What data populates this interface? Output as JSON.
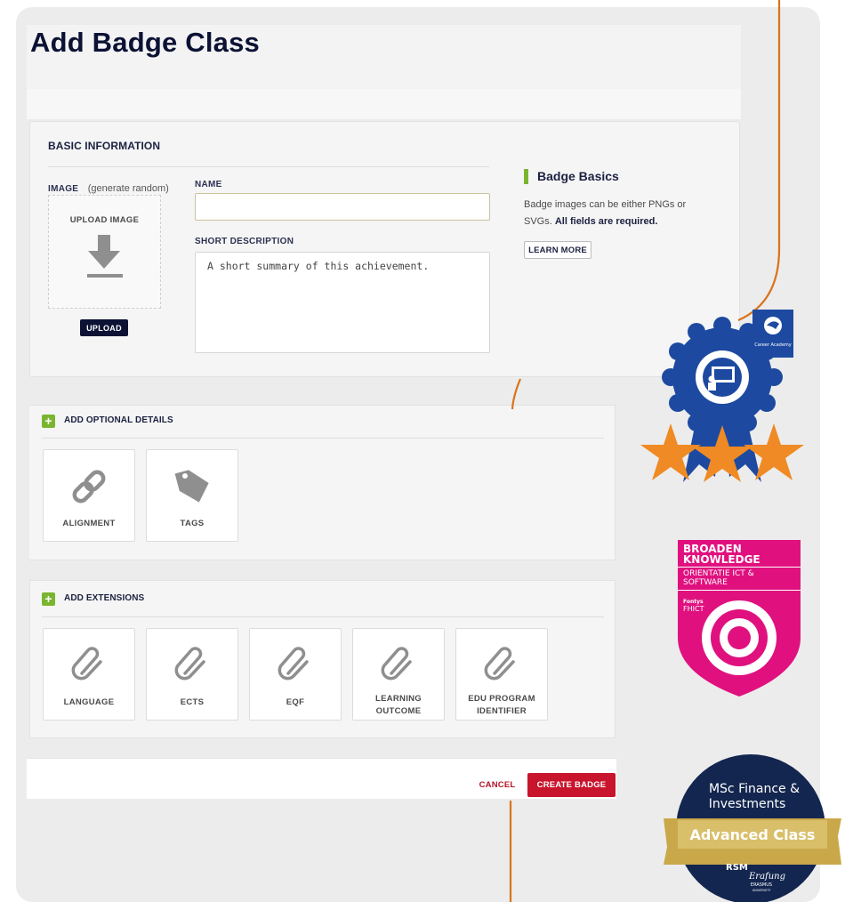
{
  "page": {
    "title": "Add Badge Class"
  },
  "basic_info": {
    "section_title": "BASIC INFORMATION",
    "image_label": "IMAGE",
    "generate_random": "(generate random)",
    "upload_image_label": "UPLOAD IMAGE",
    "upload_button": "UPLOAD",
    "name_label": "NAME",
    "name_value": "",
    "short_description_label": "SHORT DESCRIPTION",
    "short_description_placeholder": "A short summary of this achievement."
  },
  "badge_basics": {
    "title": "Badge Basics",
    "text_plain": "Badge images can be either PNGs or SVGs.",
    "text_bold": "All fields are required.",
    "learn_more": "LEARN MORE"
  },
  "optional_details": {
    "title": "ADD OPTIONAL DETAILS",
    "tiles": [
      {
        "label": "ALIGNMENT",
        "icon": "link-icon"
      },
      {
        "label": "TAGS",
        "icon": "tag-icon"
      }
    ]
  },
  "extensions": {
    "title": "ADD EXTENSIONS",
    "tiles": [
      {
        "label": "LANGUAGE",
        "icon": "paperclip-icon"
      },
      {
        "label": "ECTS",
        "icon": "paperclip-icon"
      },
      {
        "label": "EQF",
        "icon": "paperclip-icon"
      },
      {
        "label_line1": "LEARNING",
        "label_line2": "OUTCOME",
        "icon": "paperclip-icon"
      },
      {
        "label_line1": "EDU PROGRAM",
        "label_line2": "IDENTIFIER",
        "icon": "paperclip-icon"
      }
    ]
  },
  "footer": {
    "cancel": "CANCEL",
    "create": "CREATE BADGE"
  },
  "badges": {
    "career": {
      "caption": "Career Academy"
    },
    "fontys": {
      "title_line1": "BROADEN",
      "title_line2": "KNOWLEDGE",
      "subtitle_line1": "ORIENTATIE ICT &",
      "subtitle_line2": "SOFTWARE",
      "org_line1": "Fontys",
      "org_line2": "FHICT"
    },
    "rsm": {
      "title_line1": "MSc Finance &",
      "title_line2": "Investments",
      "ribbon": "Advanced Class",
      "org_short": "RSM",
      "org_script": "Erafung",
      "org_name": "ERASMUS",
      "org_sub": "UNIVERSITY"
    }
  },
  "colors": {
    "navy": "#0c1234",
    "accent_green": "#7ab530",
    "danger_red": "#c8142c",
    "connector_orange": "#d9731b",
    "badge_blue": "#1d4aa0",
    "badge_star_orange": "#f08a24",
    "fontys_pink": "#e0117f",
    "rsm_navy": "#13264f",
    "rsm_gold": "#c9a84a"
  }
}
